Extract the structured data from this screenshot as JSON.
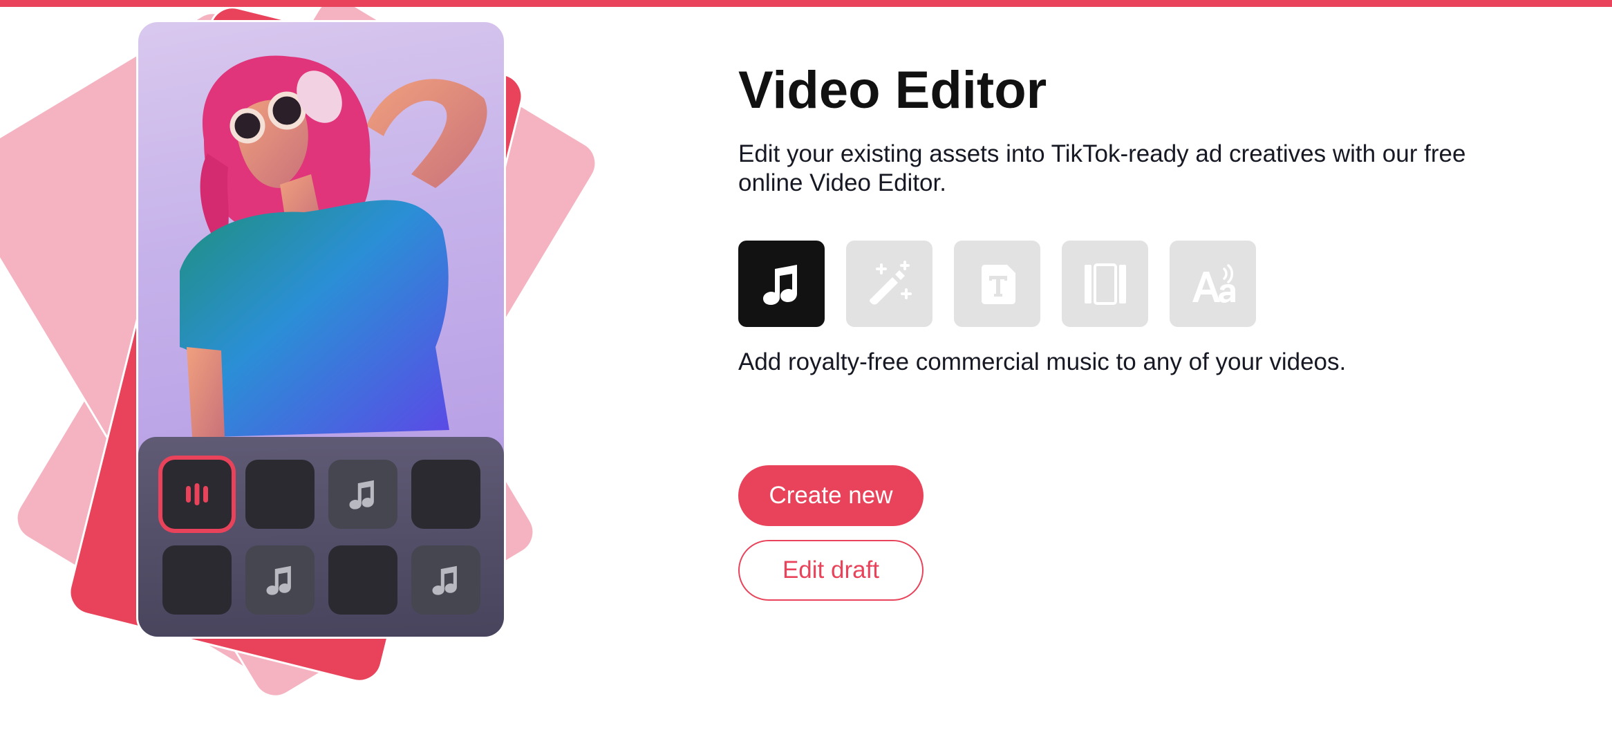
{
  "colors": {
    "accent": "#e8435a",
    "accent_light": "#f5b3c1",
    "tool_active_bg": "#121212",
    "tool_inactive_bg": "#e2e2e2",
    "text": "#161823"
  },
  "hero": {
    "title": "Video Editor",
    "description": "Edit your existing assets into TikTok-ready ad creatives with our free online Video Editor.",
    "tools": [
      {
        "icon": "music-note-icon",
        "active": true
      },
      {
        "icon": "magic-wand-icon",
        "active": false
      },
      {
        "icon": "text-icon",
        "active": false
      },
      {
        "icon": "frame-icon",
        "active": false
      },
      {
        "icon": "text-to-speech-icon",
        "active": false
      }
    ],
    "feature_caption": "Add royalty-free commercial music to any of your videos.",
    "buttons": {
      "create_new": "Create new",
      "edit_draft": "Edit draft"
    }
  },
  "illustration": {
    "tiles": [
      {
        "icon": "audio-bars-icon",
        "selected": true
      },
      {
        "icon": "",
        "selected": false
      },
      {
        "icon": "music-note-icon",
        "selected": false
      },
      {
        "icon": "",
        "selected": false
      },
      {
        "icon": "",
        "selected": false
      },
      {
        "icon": "music-note-icon",
        "selected": false
      },
      {
        "icon": "",
        "selected": false
      },
      {
        "icon": "music-note-icon",
        "selected": false
      }
    ]
  }
}
